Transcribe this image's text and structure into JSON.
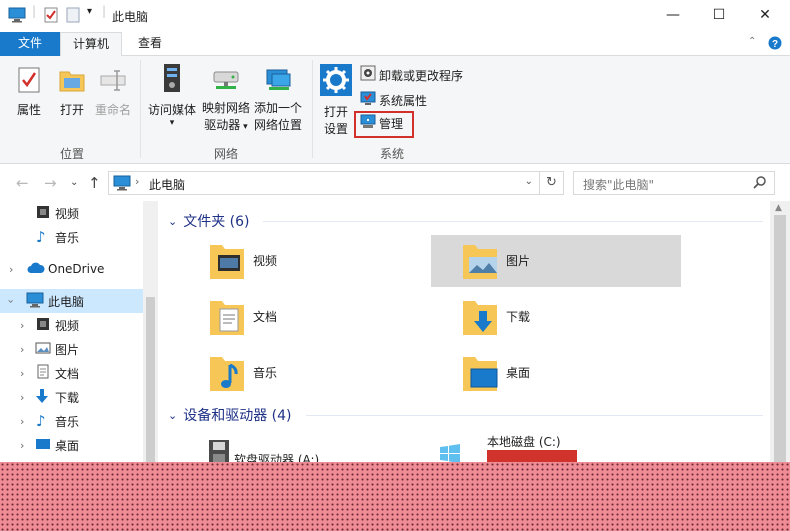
{
  "window": {
    "title": "此电脑",
    "controls": {
      "minimize": "—",
      "maximize": "☐",
      "close": "✕"
    }
  },
  "ribbon_tabs": [
    {
      "label": "文件"
    },
    {
      "label": "计算机"
    },
    {
      "label": "查看"
    }
  ],
  "ribbon": {
    "location_group": {
      "label": "位置",
      "properties": "属性",
      "open": "打开",
      "rename": "重命名"
    },
    "network_group": {
      "label": "网络",
      "media_line1": "访问媒体",
      "map_line1": "映射网络",
      "map_line2": "驱动器",
      "add_line1": "添加一个",
      "add_line2": "网络位置"
    },
    "system_group": {
      "label": "系统",
      "settings_line1": "打开",
      "settings_line2": "设置",
      "uninstall": "卸载或更改程序",
      "sys_props": "系统属性",
      "manage": "管理"
    }
  },
  "address_bar": {
    "path": "此电脑",
    "search_placeholder": "搜索\"此电脑\""
  },
  "nav_pane": {
    "items": [
      {
        "label": "视频"
      },
      {
        "label": "音乐"
      },
      {
        "label": "OneDrive"
      },
      {
        "label": "此电脑"
      },
      {
        "label": "视频"
      },
      {
        "label": "图片"
      },
      {
        "label": "文档"
      },
      {
        "label": "下载"
      },
      {
        "label": "音乐"
      },
      {
        "label": "桌面"
      }
    ]
  },
  "content": {
    "folders_header": "文件夹 (6)",
    "folders": [
      {
        "label": "视频"
      },
      {
        "label": "图片"
      },
      {
        "label": "文档"
      },
      {
        "label": "下载"
      },
      {
        "label": "音乐"
      },
      {
        "label": "桌面"
      }
    ],
    "devices_header": "设备和驱动器 (4)",
    "devices": [
      {
        "label": "软盘驱动器 (A:)"
      },
      {
        "label": "本地磁盘 (C:)"
      }
    ]
  },
  "colors": {
    "accent": "#1979ca",
    "highlight_box": "#d2302a",
    "selected_nav": "#cce8ff",
    "section_header": "#1e3287"
  }
}
